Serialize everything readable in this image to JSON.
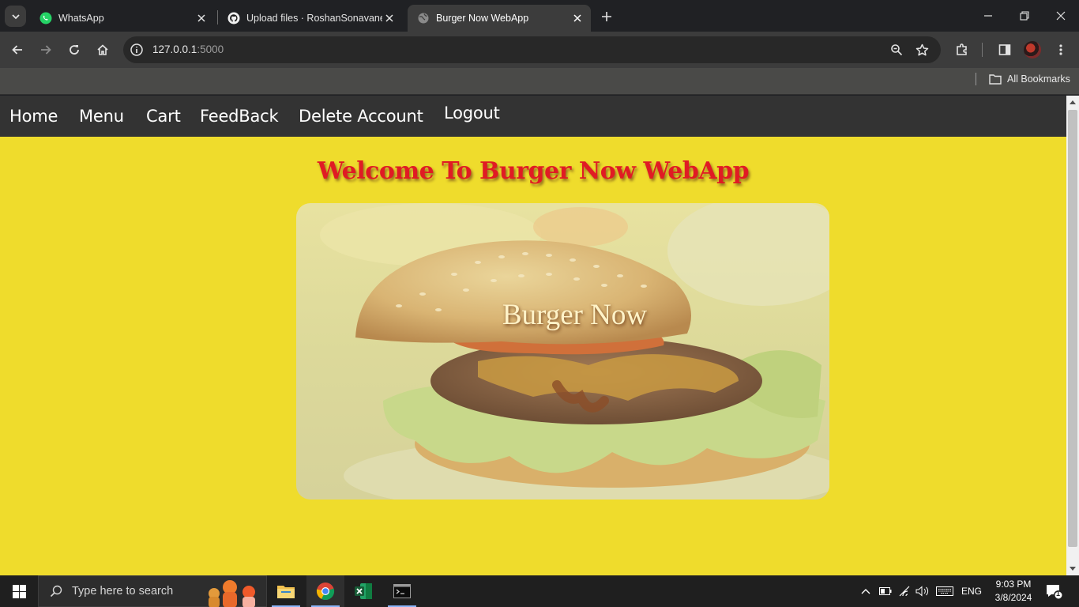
{
  "browser": {
    "tabs": [
      {
        "title": "WhatsApp",
        "icon": "whatsapp-icon",
        "active": false
      },
      {
        "title": "Upload files · RoshanSonavane/",
        "icon": "github-icon",
        "active": false
      },
      {
        "title": "Burger Now WebApp",
        "icon": "globe-icon",
        "active": true
      }
    ],
    "url": {
      "host": "127.0.0.1",
      "port": ":5000"
    },
    "bookmarks_folder": "All Bookmarks"
  },
  "page": {
    "nav": [
      "Home",
      "Menu",
      "Cart",
      "FeedBack",
      "Delete Account",
      "Logout"
    ],
    "welcome": "Welcome To Burger Now WebApp",
    "hero_title": "Burger Now",
    "colors": {
      "background": "#efdc2c",
      "navbar": "#333333",
      "welcome_text": "#e01b24"
    }
  },
  "taskbar": {
    "search_placeholder": "Type here to search",
    "language": "ENG",
    "time": "9:03 PM",
    "date": "3/8/2024",
    "notification_count": "1"
  }
}
